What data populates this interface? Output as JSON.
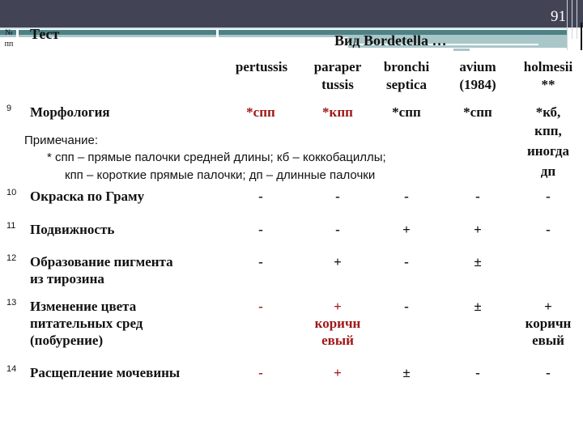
{
  "slide": {
    "number": "91"
  },
  "header": {
    "no_label": "№ пп",
    "test_label": "Тест",
    "species_group": "Вид Bordetella …",
    "species": [
      [
        "pertussis"
      ],
      [
        "paraper",
        "tussis"
      ],
      [
        "bronchi",
        "septica"
      ],
      [
        "avium",
        "(1984)"
      ],
      [
        "holmesii",
        "**"
      ]
    ]
  },
  "note": {
    "title": "Примечание:",
    "line1": "* спп – прямые палочки средней длины; кб – коккобациллы;",
    "line2": "кпп – короткие прямые палочки; дп – длинные палочки"
  },
  "rows": [
    {
      "no": "9",
      "test": [
        "Морфология"
      ],
      "test_red": true,
      "values": [
        {
          "text": [
            "*спп"
          ],
          "red": true
        },
        {
          "text": [
            "*кпп"
          ],
          "red": true
        },
        {
          "text": [
            "*спп"
          ],
          "red": false
        },
        {
          "text": [
            "*спп"
          ],
          "red": false
        },
        {
          "text": [
            "*кб,",
            "кпп,",
            "иногда",
            "дп"
          ],
          "red": false
        }
      ]
    },
    {
      "no": "10",
      "test": [
        "Окраска  по Граму"
      ],
      "test_red": false,
      "values": [
        {
          "text": [
            "-"
          ],
          "red": false
        },
        {
          "text": [
            "-"
          ],
          "red": false
        },
        {
          "text": [
            "-"
          ],
          "red": false
        },
        {
          "text": [
            "-"
          ],
          "red": false
        },
        {
          "text": [
            "-"
          ],
          "red": false
        }
      ]
    },
    {
      "no": "11",
      "test": [
        "Подвижность"
      ],
      "test_red": false,
      "values": [
        {
          "text": [
            "-"
          ],
          "red": false
        },
        {
          "text": [
            "-"
          ],
          "red": false
        },
        {
          "text": [
            "+"
          ],
          "red": false
        },
        {
          "text": [
            "+"
          ],
          "red": false
        },
        {
          "text": [
            "-"
          ],
          "red": false
        }
      ]
    },
    {
      "no": "12",
      "test": [
        "Образование пигмента",
        "из тирозина"
      ],
      "test_red": false,
      "values": [
        {
          "text": [
            "-"
          ],
          "red": false
        },
        {
          "text": [
            "+"
          ],
          "red": false
        },
        {
          "text": [
            "-"
          ],
          "red": false
        },
        {
          "text": [
            "±"
          ],
          "red": false
        },
        {
          "text": [
            ""
          ],
          "red": false
        }
      ]
    },
    {
      "no": "13",
      "test": [
        "Изменение цвета",
        "питательных сред",
        "(побурение)"
      ],
      "test_red": true,
      "values": [
        {
          "text": [
            "-"
          ],
          "red": true
        },
        {
          "text": [
            "+",
            "коричн",
            "евый"
          ],
          "red": true
        },
        {
          "text": [
            "-"
          ],
          "red": false
        },
        {
          "text": [
            "±"
          ],
          "red": false
        },
        {
          "text": [
            "+",
            "коричн",
            "евый"
          ],
          "red": false
        }
      ]
    },
    {
      "no": "14",
      "test": [
        "Расщепление мочевины"
      ],
      "test_red": true,
      "values": [
        {
          "text": [
            "-"
          ],
          "red": true
        },
        {
          "text": [
            "+"
          ],
          "red": true
        },
        {
          "text": [
            "±"
          ],
          "red": false
        },
        {
          "text": [
            "-"
          ],
          "red": false
        },
        {
          "text": [
            "-"
          ],
          "red": false
        }
      ]
    }
  ],
  "colors": {
    "accent_red": "#a01818",
    "title_bar": "#434356",
    "teal": "#4d8186",
    "light_teal": "#a9c7c9"
  }
}
